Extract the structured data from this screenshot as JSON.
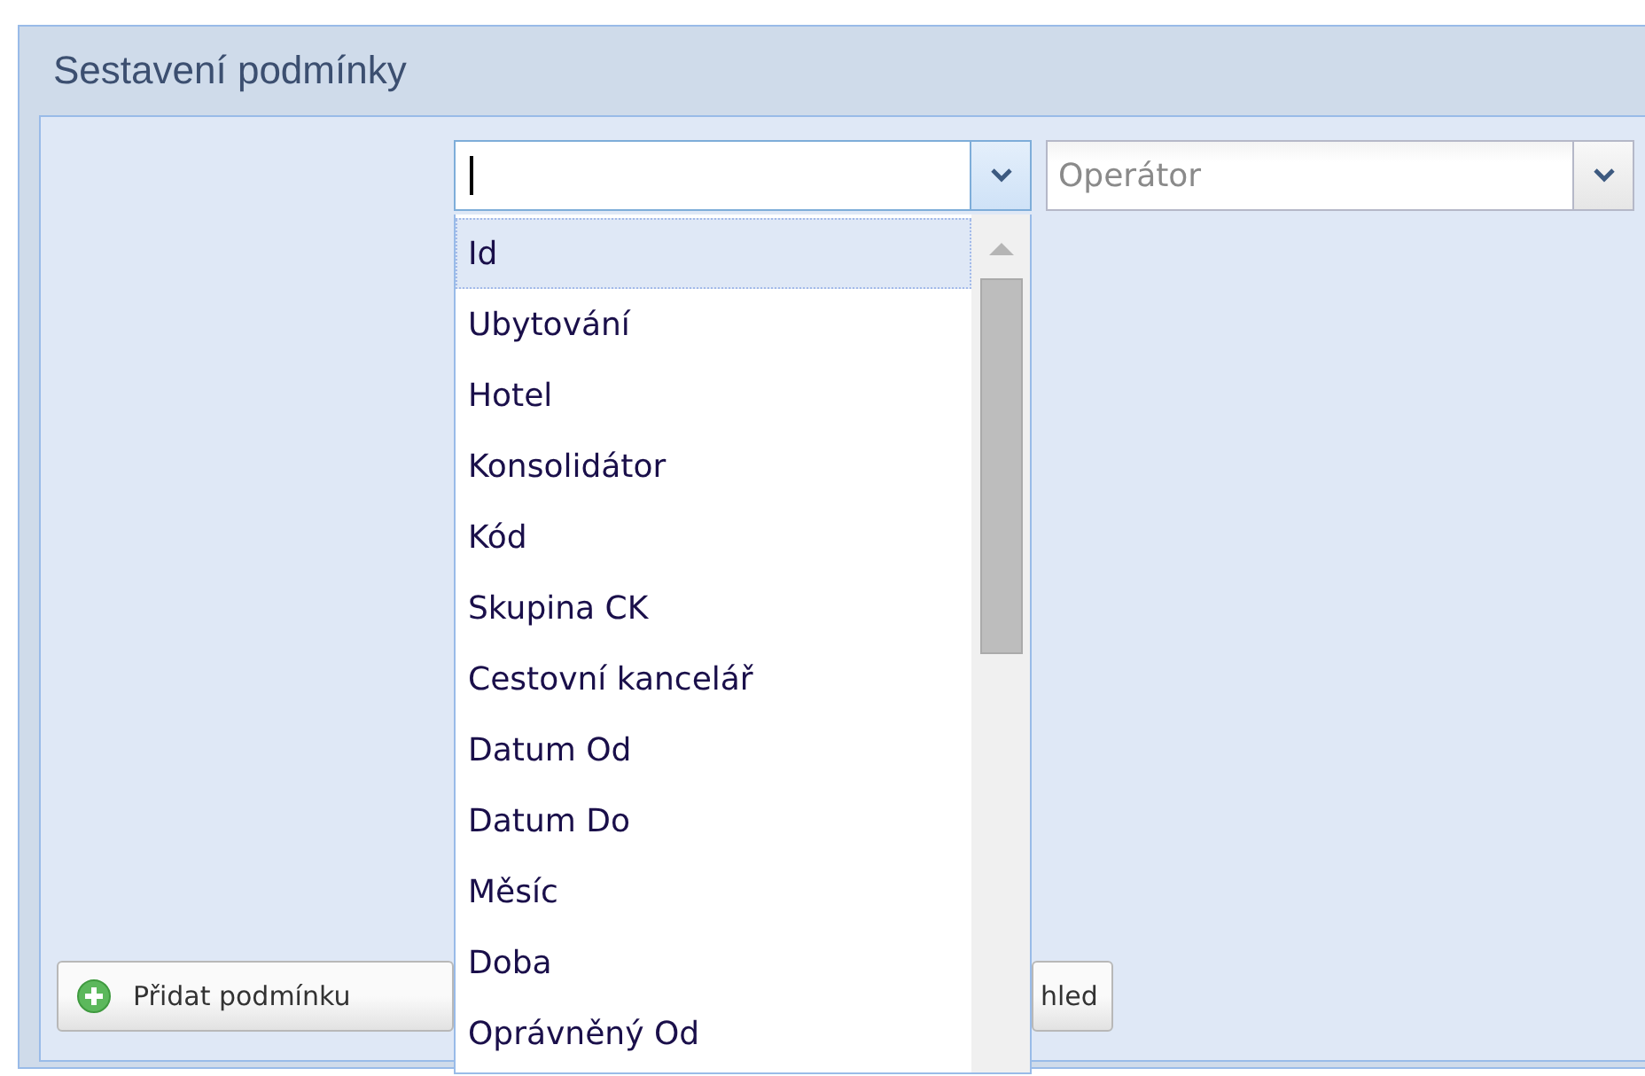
{
  "panel": {
    "title": "Sestavení podmínky"
  },
  "field_combo": {
    "focused": true
  },
  "operator_combo": {
    "placeholder": "Operátor"
  },
  "dropdown": {
    "items": [
      {
        "label": "Id",
        "selected": true
      },
      {
        "label": "Ubytování",
        "selected": false
      },
      {
        "label": "Hotel",
        "selected": false
      },
      {
        "label": "Konsolidátor",
        "selected": false
      },
      {
        "label": "Kód",
        "selected": false
      },
      {
        "label": "Skupina CK",
        "selected": false
      },
      {
        "label": "Cestovní kancelář",
        "selected": false
      },
      {
        "label": "Datum Od",
        "selected": false
      },
      {
        "label": "Datum Do",
        "selected": false
      },
      {
        "label": "Měsíc",
        "selected": false
      },
      {
        "label": "Doba",
        "selected": false
      },
      {
        "label": "Oprávněný Od",
        "selected": false
      }
    ]
  },
  "buttons": [
    {
      "label": "Přidat podmínku",
      "kind": "add"
    },
    {
      "label": "hled",
      "kind": "plain"
    }
  ]
}
